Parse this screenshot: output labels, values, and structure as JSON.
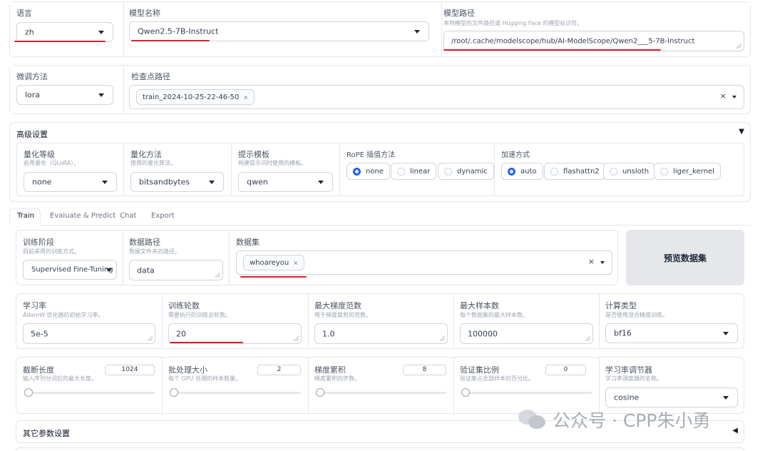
{
  "top": {
    "lang": {
      "label": "语言",
      "value": "zh"
    },
    "model_name": {
      "label": "模型名称",
      "value": "Qwen2.5-7B-Instruct"
    },
    "model_path": {
      "label": "模型路径",
      "desc": "本地模型的文件路径或 Hugging Face 的模型标识符。",
      "value": "/root/.cache/modelscope/hub/AI-ModelScope/Qwen2___5-7B-Instruct"
    }
  },
  "finetune": {
    "method": {
      "label": "微调方法",
      "value": "lora"
    },
    "checkpoint": {
      "label": "检查点路径",
      "chip": "train_2024-10-25-22-46-50",
      "chip_x": "×",
      "clear": "×"
    }
  },
  "advanced": {
    "title": "高级设置",
    "toggle": "▼",
    "quant_bit": {
      "label": "量化等级",
      "desc": "启用量化（QLoRA）。",
      "value": "none"
    },
    "quant_method": {
      "label": "量化方法",
      "desc": "使用的量化算法。",
      "value": "bitsandbytes"
    },
    "template": {
      "label": "提示模板",
      "desc": "构建提示词时使用的模板。",
      "value": "qwen"
    },
    "rope": {
      "label": "RoPE 插值方法",
      "options": [
        "none",
        "linear",
        "dynamic"
      ],
      "selected": "none"
    },
    "booster": {
      "label": "加速方式",
      "options": [
        "auto",
        "flashattn2",
        "unsloth",
        "liger_kernel"
      ],
      "selected": "auto"
    }
  },
  "tabs": [
    "Train",
    "Evaluate & Predict",
    "Chat",
    "Export"
  ],
  "active_tab": "Train",
  "train": {
    "stage": {
      "label": "训练阶段",
      "desc": "目前采用的训练方式。",
      "value": "Supervised Fine-Tuning"
    },
    "dataset_dir": {
      "label": "数据路径",
      "desc": "数据文件夹的路径。",
      "value": "data"
    },
    "dataset": {
      "label": "数据集",
      "chip": "whoareyou",
      "chip_x": "×",
      "clear": "×"
    },
    "preview_button": "预览数据集",
    "learning_rate": {
      "label": "学习率",
      "desc": "AdamW 优化器的初始学习率。",
      "value": "5e-5"
    },
    "epochs": {
      "label": "训练轮数",
      "desc": "需要执行的训练总轮数。",
      "value": "20"
    },
    "max_grad_norm": {
      "label": "最大梯度范数",
      "desc": "用于梯度裁剪的范数。",
      "value": "1.0"
    },
    "max_samples": {
      "label": "最大样本数",
      "desc": "每个数据集的最大样本数。",
      "value": "100000"
    },
    "compute_type": {
      "label": "计算类型",
      "desc": "是否使用混合精度训练。",
      "value": "bf16"
    },
    "cutoff_len": {
      "label": "截断长度",
      "desc": "输入序列分词后的最大长度。",
      "value": "1024"
    },
    "batch_size": {
      "label": "批处理大小",
      "desc": "每个 GPU 处理的样本数量。",
      "value": "2"
    },
    "grad_accum": {
      "label": "梯度累积",
      "desc": "梯度累积的步数。",
      "value": "8"
    },
    "val_size": {
      "label": "验证集比例",
      "desc": "验证集占全部样本的百分比。",
      "value": "0"
    },
    "scheduler": {
      "label": "学习率调节器",
      "desc": "学习率调度器的名称。",
      "value": "cosine"
    },
    "extra": {
      "label": "其它参数设置",
      "toggle": "◀"
    }
  },
  "watermark": "公众号 · CPP朱小勇",
  "colors": {
    "accent": "#2563eb",
    "annotation_red": "#e11d2a",
    "border": "#e5e7eb"
  }
}
